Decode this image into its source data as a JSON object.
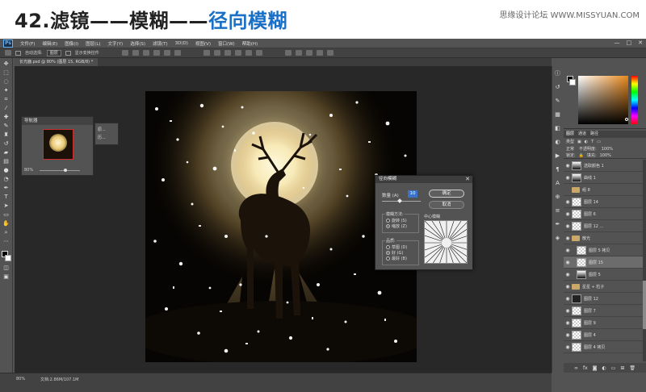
{
  "banner": {
    "title_prefix": "42.滤镜——模糊——",
    "title_highlight": "径向模糊",
    "watermark": "思缘设计论坛 WWW.MISSYUAN.COM"
  },
  "menubar": {
    "logo": "Ps",
    "items": [
      "文件(F)",
      "编辑(E)",
      "图像(I)",
      "图层(L)",
      "文字(Y)",
      "选择(S)",
      "滤镜(T)",
      "3D(D)",
      "视图(V)",
      "窗口(W)",
      "帮助(H)"
    ],
    "window_controls": [
      "—",
      "□",
      "✕"
    ]
  },
  "optionsbar": {
    "auto_select_label": "自动选择:",
    "auto_select_value": "图层",
    "show_transform_label": "显示变换控件"
  },
  "document": {
    "tab_label": "长光鹿.psd @ 80% (图层 15, RGB/8) *"
  },
  "navigator": {
    "title": "导航器",
    "zoom": "80%",
    "zoom_percent": 80
  },
  "minipanel": {
    "items": [
      "原...",
      "历..."
    ]
  },
  "dialog": {
    "title": "径向模糊",
    "close": "✕",
    "amount_label": "数量 (A)",
    "amount_value": "10",
    "ok_label": "确定",
    "cancel_label": "取消",
    "method_label": "模糊方法:",
    "methods": [
      {
        "label": "旋转 (S)",
        "selected": false
      },
      {
        "label": "缩放 (Z)",
        "selected": true
      }
    ],
    "quality_label": "品质:",
    "qualities": [
      {
        "label": "草图 (D)",
        "selected": false
      },
      {
        "label": "好 (G)",
        "selected": true
      },
      {
        "label": "最好 (B)",
        "selected": false
      }
    ],
    "center_label": "中心模糊"
  },
  "layers": {
    "tabs": [
      "图层",
      "通道",
      "路径"
    ],
    "filter_label": "类型",
    "blend_mode": "正常",
    "opacity_label": "不透明度:",
    "opacity": "100%",
    "lock_label": "锁定:",
    "fill_label": "填充:",
    "fill": "100%",
    "rows": [
      {
        "name": "选取颜色 1",
        "thumb": "mask",
        "eye": true,
        "indent": false,
        "selected": false
      },
      {
        "name": "曲线 1",
        "thumb": "mask",
        "eye": true,
        "indent": false,
        "selected": false
      },
      {
        "name": "组 8",
        "thumb": "folder",
        "eye": false,
        "indent": false,
        "selected": false
      },
      {
        "name": "图层 14",
        "thumb": "plain",
        "eye": true,
        "indent": false,
        "selected": false
      },
      {
        "name": "图层 6",
        "thumb": "plain",
        "eye": true,
        "indent": false,
        "selected": false
      },
      {
        "name": "图层 12 ...",
        "thumb": "plain",
        "eye": true,
        "indent": false,
        "selected": false
      },
      {
        "name": "散光",
        "thumb": "folder",
        "eye": true,
        "indent": false,
        "selected": false
      },
      {
        "name": "图层 5 拷贝",
        "thumb": "plain",
        "eye": true,
        "indent": true,
        "selected": false
      },
      {
        "name": "图层 15",
        "thumb": "plain",
        "eye": true,
        "indent": true,
        "selected": true
      },
      {
        "name": "图层 5",
        "thumb": "mask",
        "eye": true,
        "indent": true,
        "selected": false
      },
      {
        "name": "星星 + 粒子",
        "thumb": "folder",
        "eye": true,
        "indent": false,
        "selected": false
      },
      {
        "name": "图层 12",
        "thumb": "dark",
        "eye": true,
        "indent": false,
        "selected": false
      },
      {
        "name": "图层 7",
        "thumb": "plain",
        "eye": true,
        "indent": false,
        "selected": false
      },
      {
        "name": "图层 9",
        "thumb": "plain",
        "eye": true,
        "indent": false,
        "selected": false
      },
      {
        "name": "图层 4",
        "thumb": "plain",
        "eye": true,
        "indent": false,
        "selected": false
      },
      {
        "name": "图层 4 拷贝",
        "thumb": "plain",
        "eye": true,
        "indent": false,
        "selected": false
      }
    ],
    "footer_icons": [
      "∞",
      "fx",
      "◙",
      "◐",
      "▭",
      "⊞",
      "🗑"
    ]
  },
  "statusbar": {
    "zoom": "80%",
    "doc_info": "文档:2.86M/107.1M"
  },
  "colors": {
    "accent_blue": "#1a6fc6",
    "panel_bg": "#535353",
    "canvas_bg": "#282828",
    "moon_glow": "#f6e7b0"
  }
}
